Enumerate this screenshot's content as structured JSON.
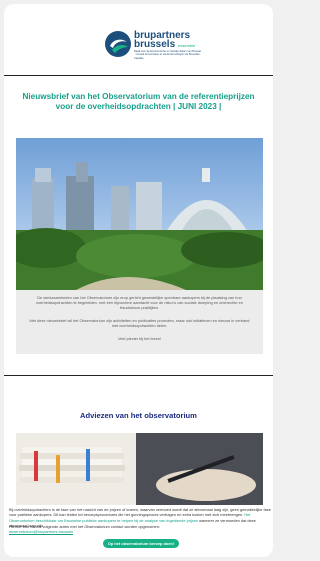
{
  "logo": {
    "word_top": "brupartners",
    "word_bottom": "brussels",
    "suffix": "ensemble",
    "tagline": "Raad voor de Economische en Sociale Zaken van Brussel · Conseil économique et social de la Région de Bruxelles-Capitale"
  },
  "newsletter": {
    "title": "Nieuwsbrief van het Observatorium van de referentieprijzen voor de overheidsopdrachten | JUNI 2023 |"
  },
  "intro": {
    "p1": "De werkzaamheden van het Observatorium zijn erop gericht gewestelijke openbare aankopers bij de plaatsing van hun overheidsopdrachten te begeleiden, met een bijzondere aandacht voor de risico's van sociale dumping en onterechte en frauduleuze praktijken.",
    "p2": "Met deze nieuwsbrief wil het Observatorium zijn activiteiten en publicaties promoten, maar ook initiatieven en nieuws in verband met overheidsopdrachten delen.",
    "p3": "Veel plezier bij het lezen!"
  },
  "advice": {
    "heading": "Adviezen van het observatorium",
    "body_start": "Bij overheidsopdrachten is de fase van het nazicht van de prijzen of kosten, waarvan vermoed wordt dat ze abnormaal laag zijn, geen gemakkelijke fase voor publieke aankopers. Dit kan leiden tot beroepsprocedures die het gunningsproces vertragen en extra kosten met zich meebrengen.",
    "body_link": "Het Observatorium beschikbaar om Brusselse publieke aankopers te helpen bij de analyse van ingediende prijzen",
    "body_end": "wanneer ze vermoeden dat deze abnormaal laag zijn.",
    "contact_text": "Hiertoe kan via het volgende adres met het Observatorium contact worden opgenomen:",
    "email": "observatorium@brupartners.brussels",
    "cta": "Op het observatorium beroep doen!"
  }
}
